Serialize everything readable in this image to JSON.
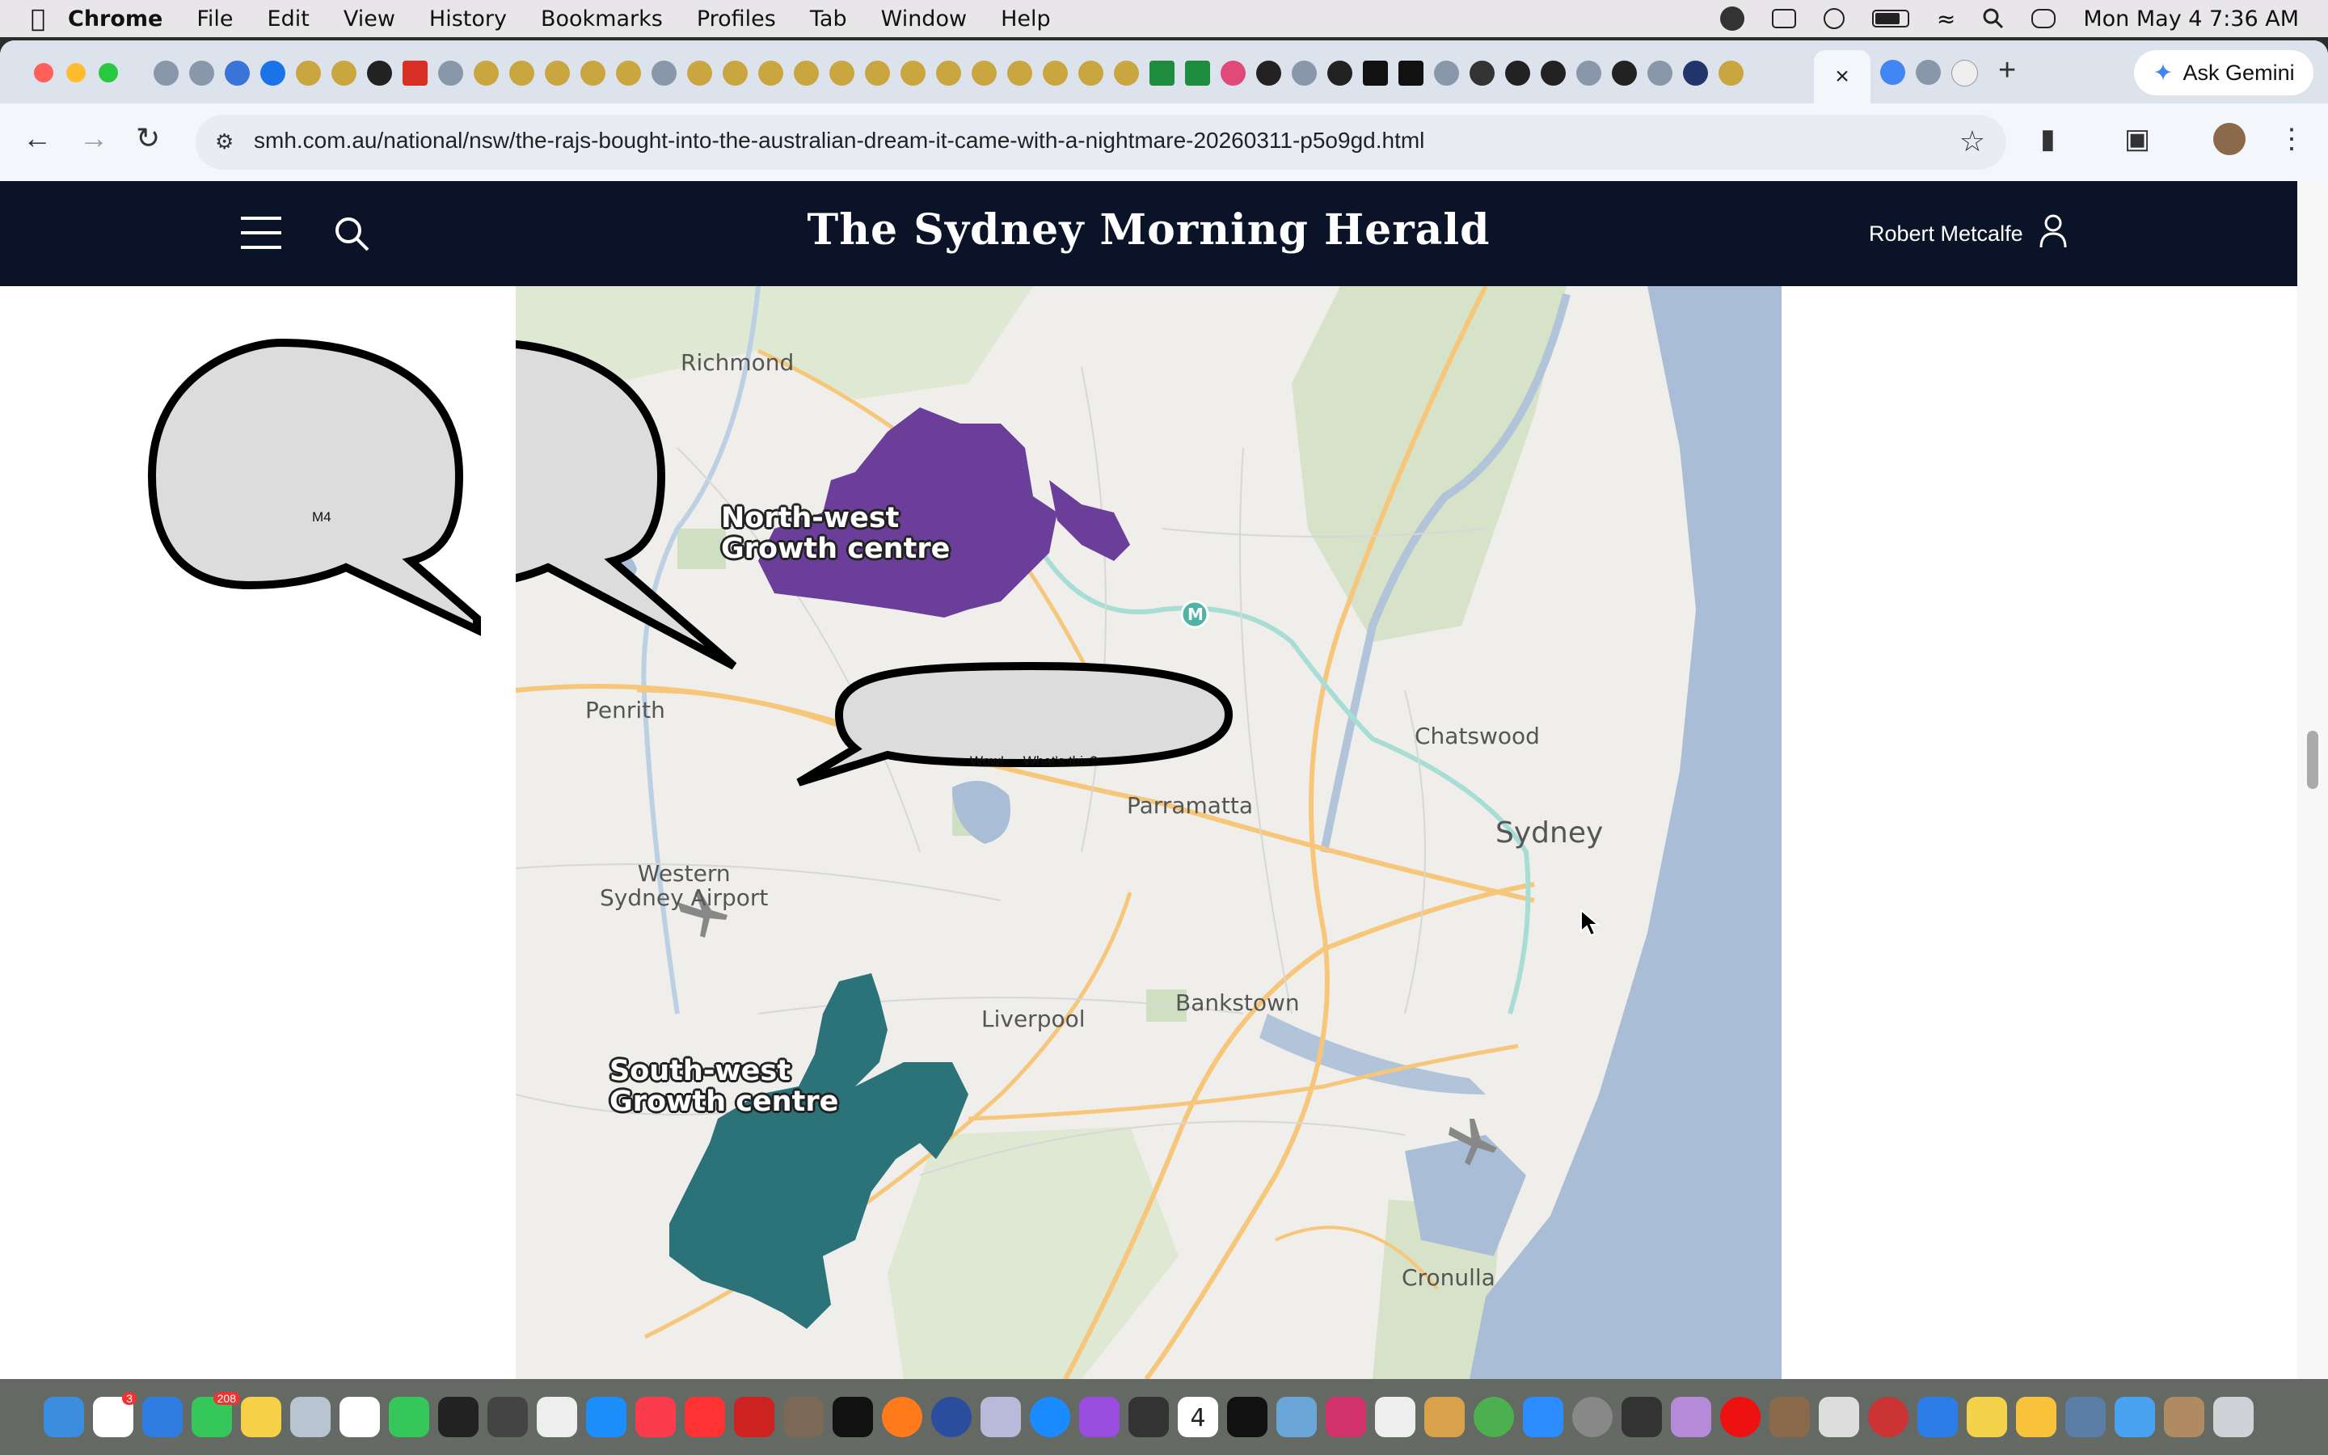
{
  "menubar": {
    "app": "Chrome",
    "items": [
      "File",
      "Edit",
      "View",
      "History",
      "Bookmarks",
      "Profiles",
      "Tab",
      "Window",
      "Help"
    ],
    "datetime": "Mon May 4  7:36 AM"
  },
  "browser": {
    "url": "smh.com.au/national/nsw/the-rajs-bought-into-the-australian-dream-it-came-with-a-nightmare-20260311-p5o9gd.html",
    "active_tab_close": "×",
    "new_tab": "+",
    "gemini_label": "Ask Gemini"
  },
  "site": {
    "masthead": "The Sydney Morning Herald",
    "user_name": "Robert Metcalfe"
  },
  "map": {
    "places": {
      "richmond": "Richmond",
      "penrith": "Penrith",
      "parramatta": "Parramatta",
      "chatswood": "Chatswood",
      "sydney": "Sydney",
      "western_airport": "Western\nSydney Airport",
      "liverpool": "Liverpool",
      "bankstown": "Bankstown",
      "cronulla": "Cronulla"
    },
    "metro_marker": "M",
    "growth_centres": {
      "north_west_line1": "North-west",
      "north_west_line2": "Growth centre",
      "south_west_line1": "South-west",
      "south_west_line2": "Growth centre"
    },
    "colors": {
      "north_west": "#6b3e99",
      "south_west": "#2b7378",
      "water": "#a9bdd6",
      "park": "#cfe0c2"
    }
  },
  "bubbles": {
    "left": "M4",
    "center": "Wow!     What's this?"
  },
  "dock": {
    "calendar_day": "4",
    "messages_badge": "208",
    "reminders_badge": "3"
  }
}
